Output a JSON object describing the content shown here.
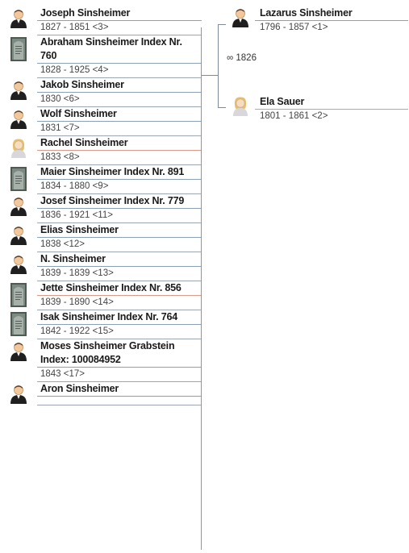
{
  "father": {
    "name": "Lazarus Sinsheimer",
    "dates": "1796 - 1857 <1>",
    "gender": "male",
    "sep_color": "#8aa0b8"
  },
  "mother": {
    "name": "Ela Sauer",
    "dates": "1801 - 1861 <2>",
    "gender": "female",
    "sep_color": "#d99a8a"
  },
  "marriage": {
    "label": "∞ 1826"
  },
  "children": [
    {
      "name": "Joseph Sinsheimer",
      "dates": "1827 - 1851 <3>",
      "pic": "male",
      "sep_color": "#8aa0b8"
    },
    {
      "name": "Abraham Sinsheimer Index Nr. 760",
      "dates": "1828 - 1925 <4>",
      "pic": "photo",
      "sep_color": "#8aa0b8"
    },
    {
      "name": "Jakob Sinsheimer",
      "dates": "1830 <6>",
      "pic": "male",
      "sep_color": "#8aa0b8"
    },
    {
      "name": "Wolf Sinsheimer",
      "dates": "1831 <7>",
      "pic": "male",
      "sep_color": "#8aa0b8"
    },
    {
      "name": "Rachel Sinsheimer",
      "dates": "1833 <8>",
      "pic": "female",
      "sep_color": "#d99a8a"
    },
    {
      "name": "Maier Sinsheimer Index Nr. 891",
      "dates": "1834 - 1880 <9>",
      "pic": "photo",
      "sep_color": "#8aa0b8"
    },
    {
      "name": "Josef Sinsheimer Index Nr. 779",
      "dates": "1836 - 1921 <11>",
      "pic": "male",
      "sep_color": "#8aa0b8"
    },
    {
      "name": "Elias Sinsheimer",
      "dates": "1838 <12>",
      "pic": "male",
      "sep_color": "#8aa0b8"
    },
    {
      "name": "N. Sinsheimer",
      "dates": "1839 - 1839 <13>",
      "pic": "male",
      "sep_color": "#8aa0b8"
    },
    {
      "name": "Jette Sinsheimer Index Nr. 856",
      "dates": "1839 - 1890 <14>",
      "pic": "photo",
      "sep_color": "#d99a8a"
    },
    {
      "name": "Isak Sinsheimer Index Nr. 764",
      "dates": "1842 - 1922 <15>",
      "pic": "photo",
      "sep_color": "#8aa0b8"
    },
    {
      "name": "Moses Sinsheimer Grabstein Index: 100084952",
      "dates": "1843 <17>",
      "pic": "male",
      "sep_color": "#8aa0b8"
    },
    {
      "name": "Aron Sinsheimer",
      "dates": "",
      "pic": "male",
      "sep_color": "#8aa0b8"
    }
  ]
}
